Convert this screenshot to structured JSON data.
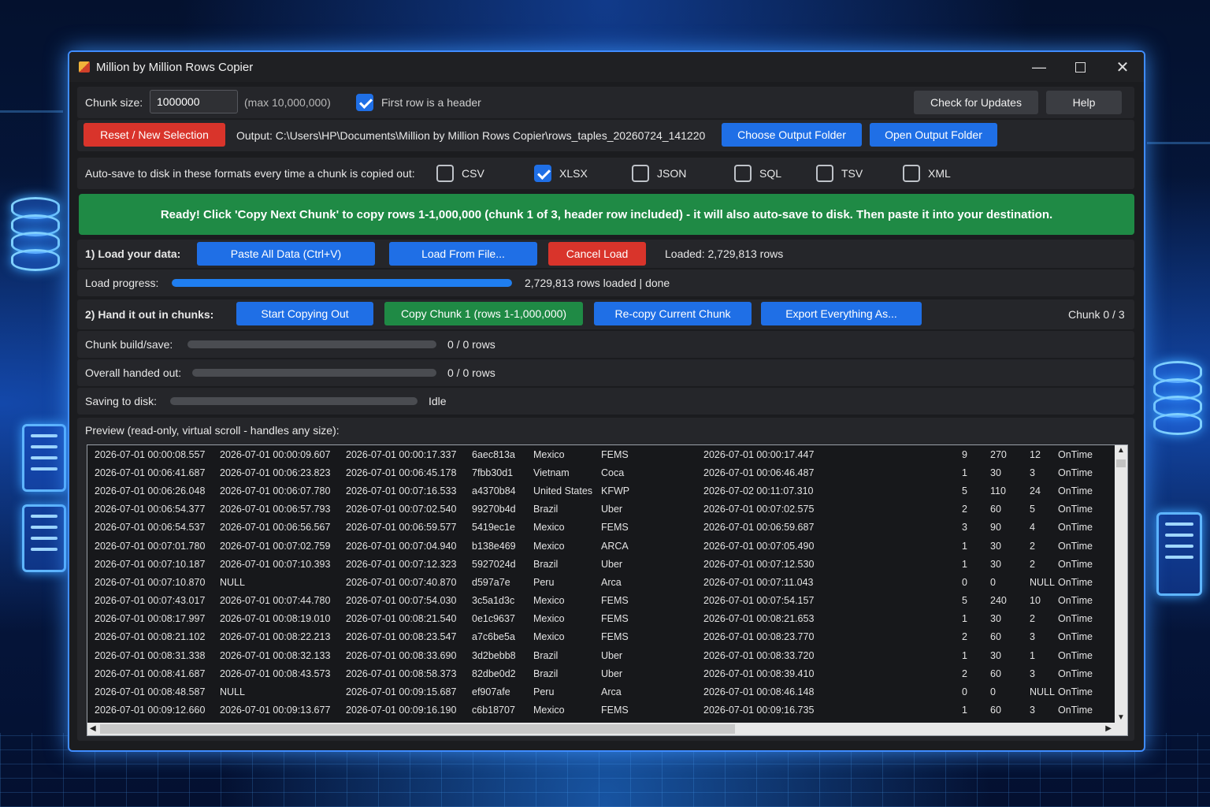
{
  "window": {
    "title": "Million by Million Rows Copier"
  },
  "settings": {
    "chunk_size_label": "Chunk size:",
    "chunk_size_value": "1000000",
    "chunk_size_hint": "(max 10,000,000)",
    "header_checkbox_label": "First row is a header",
    "header_checked": true,
    "check_updates_label": "Check for Updates",
    "help_label": "Help"
  },
  "output": {
    "reset_label": "Reset / New Selection",
    "path_text": "Output: C:\\Users\\HP\\Documents\\Million by Million Rows Copier\\rows_taples_20260724_141220",
    "choose_folder_label": "Choose Output Folder",
    "open_folder_label": "Open Output Folder"
  },
  "autosave": {
    "label": "Auto-save to disk in these formats every time a chunk is copied out:",
    "formats": [
      {
        "label": "CSV",
        "checked": false
      },
      {
        "label": "XLSX",
        "checked": true
      },
      {
        "label": "JSON",
        "checked": false
      },
      {
        "label": "SQL",
        "checked": false
      },
      {
        "label": "TSV",
        "checked": false
      },
      {
        "label": "XML",
        "checked": false
      }
    ]
  },
  "banner": {
    "text": "Ready! Click 'Copy Next Chunk' to copy rows 1-1,000,000 (chunk 1 of 3, header row included) - it will also auto-save to disk. Then paste it into your destination."
  },
  "load": {
    "section_label": "1) Load your data:",
    "paste_label": "Paste All Data (Ctrl+V)",
    "load_file_label": "Load From File...",
    "cancel_label": "Cancel Load",
    "loaded_text": "Loaded: 2,729,813 rows",
    "progress_label": "Load progress:",
    "progress_fraction": 1.0,
    "progress_text": "2,729,813 rows loaded | done"
  },
  "chunks": {
    "section_label": "2) Hand it out in chunks:",
    "start_label": "Start Copying Out",
    "copy_chunk_label": "Copy Chunk 1 (rows 1-1,000,000)",
    "recopy_label": "Re-copy Current Chunk",
    "export_label": "Export Everything As...",
    "counter_text": "Chunk 0 / 3",
    "build_label": "Chunk build/save:",
    "build_fraction": 0.0,
    "build_text": "0 / 0 rows",
    "overall_label": "Overall handed out:",
    "overall_fraction": 0.0,
    "overall_text": "0 / 0 rows",
    "saving_label": "Saving to disk:",
    "saving_fraction": 0.0,
    "saving_text": "Idle"
  },
  "preview": {
    "label": "Preview (read-only, virtual scroll - handles any size):",
    "rows": [
      [
        "2026-07-01 00:00:08.557",
        "2026-07-01 00:00:09.607",
        "2026-07-01 00:00:17.337",
        "6aec813a",
        "Mexico",
        "FEMS",
        "2026-07-01 00:00:17.447",
        "9",
        "270",
        "12",
        "OnTime"
      ],
      [
        "2026-07-01 00:06:41.687",
        "2026-07-01 00:06:23.823",
        "2026-07-01 00:06:45.178",
        "7fbb30d1",
        "Vietnam",
        "Coca",
        "2026-07-01 00:06:46.487",
        "1",
        "30",
        "3",
        "OnTime"
      ],
      [
        "2026-07-01 00:06:26.048",
        "2026-07-01 00:06:07.780",
        "2026-07-01 00:07:16.533",
        "a4370b84",
        "United States",
        "KFWP",
        "2026-07-02 00:11:07.310",
        "5",
        "110",
        "24",
        "OnTime"
      ],
      [
        "2026-07-01 00:06:54.377",
        "2026-07-01 00:06:57.793",
        "2026-07-01 00:07:02.540",
        "99270b4d",
        "Brazil",
        "Uber",
        "2026-07-01 00:07:02.575",
        "2",
        "60",
        "5",
        "OnTime"
      ],
      [
        "2026-07-01 00:06:54.537",
        "2026-07-01 00:06:56.567",
        "2026-07-01 00:06:59.577",
        "5419ec1e",
        "Mexico",
        "FEMS",
        "2026-07-01 00:06:59.687",
        "3",
        "90",
        "4",
        "OnTime"
      ],
      [
        "2026-07-01 00:07:01.780",
        "2026-07-01 00:07:02.759",
        "2026-07-01 00:07:04.940",
        "b138e469",
        "Mexico",
        "ARCA",
        "2026-07-01 00:07:05.490",
        "1",
        "30",
        "2",
        "OnTime"
      ],
      [
        "2026-07-01 00:07:10.187",
        "2026-07-01 00:07:10.393",
        "2026-07-01 00:07:12.323",
        "5927024d",
        "Brazil",
        "Uber",
        "2026-07-01 00:07:12.530",
        "1",
        "30",
        "2",
        "OnTime"
      ],
      [
        "2026-07-01 00:07:10.870",
        "NULL",
        "2026-07-01 00:07:40.870",
        "d597a7e",
        "Peru",
        "Arca",
        "2026-07-01 00:07:11.043",
        "0",
        "0",
        "NULL",
        "OnTime"
      ],
      [
        "2026-07-01 00:07:43.017",
        "2026-07-01 00:07:44.780",
        "2026-07-01 00:07:54.030",
        "3c5a1d3c",
        "Mexico",
        "FEMS",
        "2026-07-01 00:07:54.157",
        "5",
        "240",
        "10",
        "OnTime"
      ],
      [
        "2026-07-01 00:08:17.997",
        "2026-07-01 00:08:19.010",
        "2026-07-01 00:08:21.540",
        "0e1c9637",
        "Mexico",
        "FEMS",
        "2026-07-01 00:08:21.653",
        "1",
        "30",
        "2",
        "OnTime"
      ],
      [
        "2026-07-01 00:08:21.102",
        "2026-07-01 00:08:22.213",
        "2026-07-01 00:08:23.547",
        "a7c6be5a",
        "Mexico",
        "FEMS",
        "2026-07-01 00:08:23.770",
        "2",
        "60",
        "3",
        "OnTime"
      ],
      [
        "2026-07-01 00:08:31.338",
        "2026-07-01 00:08:32.133",
        "2026-07-01 00:08:33.690",
        "3d2bebb8",
        "Brazil",
        "Uber",
        "2026-07-01 00:08:33.720",
        "1",
        "30",
        "1",
        "OnTime"
      ],
      [
        "2026-07-01 00:08:41.687",
        "2026-07-01 00:08:43.573",
        "2026-07-01 00:08:58.373",
        "82dbe0d2",
        "Brazil",
        "Uber",
        "2026-07-01 00:08:39.410",
        "2",
        "60",
        "3",
        "OnTime"
      ],
      [
        "2026-07-01 00:08:48.587",
        "NULL",
        "2026-07-01 00:09:15.687",
        "ef907afe",
        "Peru",
        "Arca",
        "2026-07-01 00:08:46.148",
        "0",
        "0",
        "NULL",
        "OnTime"
      ],
      [
        "2026-07-01 00:09:12.660",
        "2026-07-01 00:09:13.677",
        "2026-07-01 00:09:16.190",
        "c6b18707",
        "Mexico",
        "FEMS",
        "2026-07-01 00:09:16.735",
        "1",
        "60",
        "3",
        "OnTime"
      ]
    ]
  }
}
